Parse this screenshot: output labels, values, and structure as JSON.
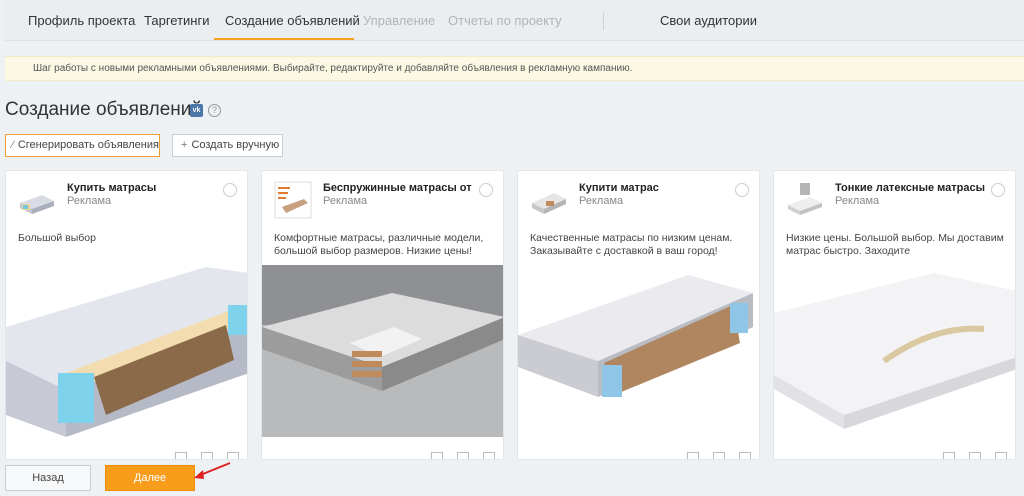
{
  "nav": {
    "tabs": [
      {
        "label": "Профиль проекта"
      },
      {
        "label": "Таргетинги"
      },
      {
        "label": "Создание объявлений"
      },
      {
        "label": "Управление"
      },
      {
        "label": "Отчеты по проекту"
      },
      {
        "label": "Свои аудитории"
      }
    ]
  },
  "info": {
    "text": "Шаг работы с новыми рекламными объявлениями. Выбирайте, редактируйте и добавляйте объявления в рекламную кампанию."
  },
  "page": {
    "title": "Создание объявлений",
    "vk_badge": "vk",
    "help": "?"
  },
  "toolbar": {
    "generate_label": "Сгенерировать объявления",
    "manual_label": "Создать вручную"
  },
  "cards": [
    {
      "title": "Купить матрасы",
      "subtitle": "Реклама",
      "text": "Большой выбор"
    },
    {
      "title": "Беспружинные матрасы от",
      "subtitle": "Реклама",
      "text": "Комфортные матрасы, различные модели, большой выбор размеров. Низкие цены!"
    },
    {
      "title": "Купити матрас",
      "subtitle": "Реклама",
      "text": "Качественные матрасы по низким ценам. Заказывайте с доставкой в ваш город!"
    },
    {
      "title": "Тонкие латексные матрасы",
      "subtitle": "Реклама",
      "text": "Низкие цены. Большой выбор. Мы доставим матрас быстро. Заходите"
    }
  ],
  "footer": {
    "back_label": "Назад",
    "next_label": "Далее"
  },
  "colors": {
    "accent": "#f89c1c",
    "tab_underline": "#f7a11a",
    "info_bg": "#fbf8e4",
    "vk_blue": "#4a76a8"
  }
}
